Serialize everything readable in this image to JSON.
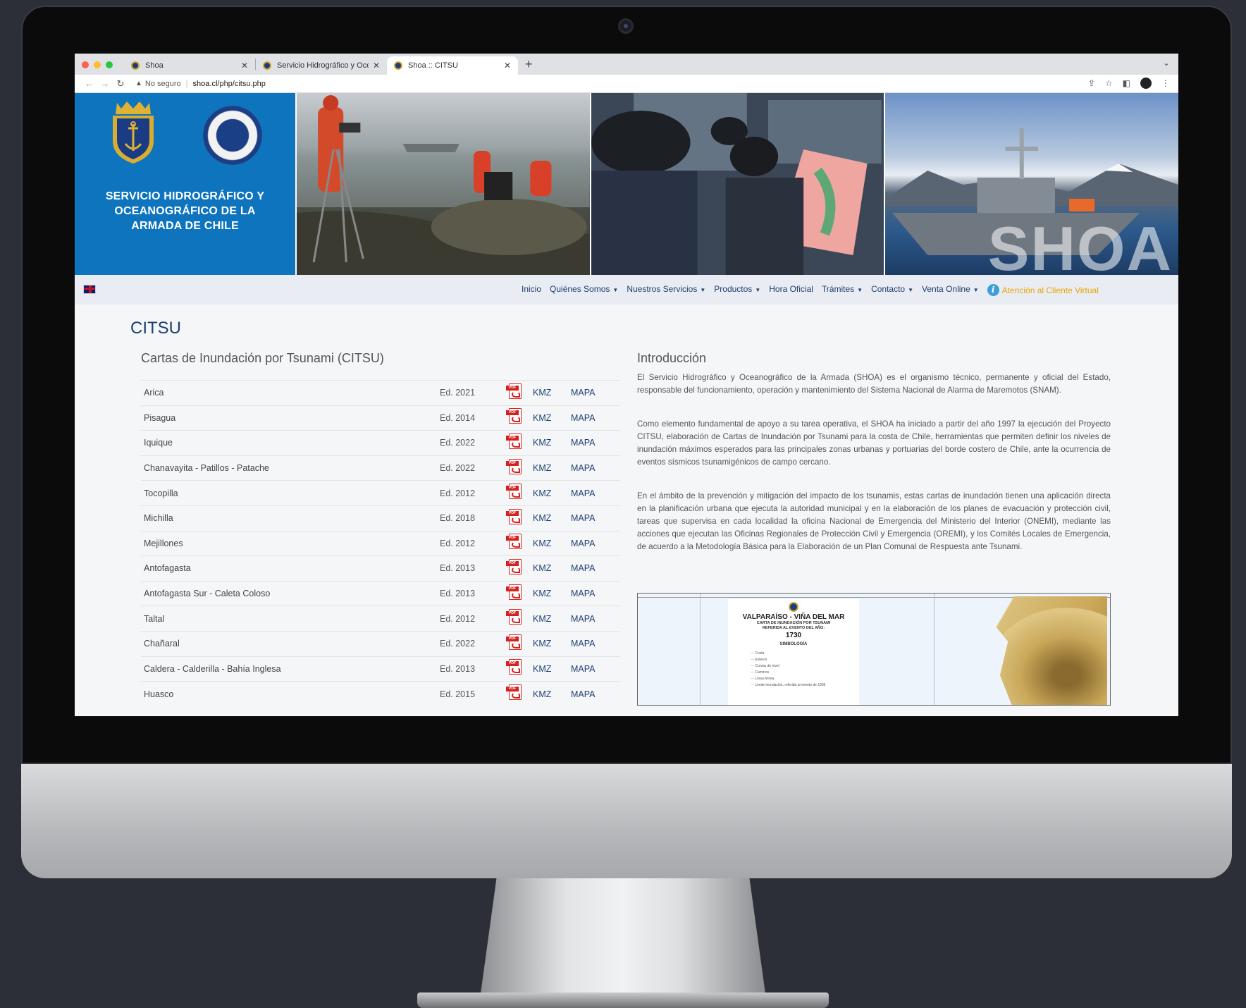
{
  "browser": {
    "tabs": [
      {
        "title": "Shoa",
        "active": false
      },
      {
        "title": "Servicio Hidrográfico y Oceanó",
        "active": false
      },
      {
        "title": "Shoa :: CITSU",
        "active": true
      }
    ],
    "security_label": "No seguro",
    "url_host": "shoa.cl",
    "url_path": "/php/citsu.php"
  },
  "banner": {
    "org_name": "SERVICIO HIDROGRÁFICO Y OCEANOGRÁFICO DE LA ARMADA DE CHILE",
    "watermark": "SHOA",
    "brand_color": "#0d74bd"
  },
  "nav": {
    "items": [
      {
        "label": "Inicio",
        "dropdown": false
      },
      {
        "label": "Quiénes Somos",
        "dropdown": true
      },
      {
        "label": "Nuestros Servicios",
        "dropdown": true
      },
      {
        "label": "Productos",
        "dropdown": true
      },
      {
        "label": "Hora Oficial",
        "dropdown": false
      },
      {
        "label": "Trámites",
        "dropdown": true
      },
      {
        "label": "Contacto",
        "dropdown": true
      },
      {
        "label": "Venta Online",
        "dropdown": true
      }
    ],
    "assist_label": "Atención al Cliente Virtual",
    "assist_color": "#e8a300"
  },
  "page": {
    "title": "CITSU",
    "section_title": "Cartas de Inundación por Tsunami (CITSU)",
    "kmz_label": "KMZ",
    "mapa_label": "MAPA",
    "charts": [
      {
        "name": "Arica",
        "edition": "Ed. 2021"
      },
      {
        "name": "Pisagua",
        "edition": "Ed. 2014"
      },
      {
        "name": "Iquique",
        "edition": "Ed. 2022"
      },
      {
        "name": "Chanavayita - Patillos - Patache",
        "edition": "Ed. 2022"
      },
      {
        "name": "Tocopilla",
        "edition": "Ed. 2012"
      },
      {
        "name": "Michilla",
        "edition": "Ed. 2018"
      },
      {
        "name": "Mejillones",
        "edition": "Ed. 2012"
      },
      {
        "name": "Antofagasta",
        "edition": "Ed. 2013"
      },
      {
        "name": "Antofagasta Sur - Caleta Coloso",
        "edition": "Ed. 2013"
      },
      {
        "name": "Taltal",
        "edition": "Ed. 2012"
      },
      {
        "name": "Chañaral",
        "edition": "Ed. 2022"
      },
      {
        "name": "Caldera - Calderilla - Bahía Inglesa",
        "edition": "Ed. 2013"
      },
      {
        "name": "Huasco",
        "edition": "Ed. 2015"
      }
    ]
  },
  "intro": {
    "title": "Introducción",
    "paragraphs": [
      "El Servicio Hidrográfico y Oceanográfico de la Armada (SHOA) es el organismo técnico, permanente y oficial del Estado, responsable del funcionamiento, operación y mantenimiento del Sistema Nacional de Alarma de Maremotos (SNAM).",
      "Como elemento fundamental de apoyo a su tarea operativa, el SHOA ha iniciado a partir del año 1997 la ejecución del Proyecto CITSU, elaboración de Cartas de Inundación por Tsunami para la costa de Chile, herramientas que permiten definir los niveles de inundación máximos esperados para las principales zonas urbanas y portuarias del borde costero de Chile, ante la ocurrencia de eventos sísmicos tsunamigénicos de campo cercano.",
      "En el ámbito de la prevención y mitigación del impacto de los tsunamis, estas cartas de inundación tienen una aplicación directa en la planificación urbana que ejecuta la autoridad municipal y en la elaboración de los planes de evacuación y protección civil, tareas que supervisa en cada localidad la oficina Nacional de Emergencia del Ministerio del Interior (ONEMI), mediante las acciones que ejecutan las Oficinas Regionales de Protección Civil y Emergencia (OREMI), y los Comités Locales de Emergencia, de acuerdo a la Metodología Básica para la Elaboración de un Plan Comunal de Respuesta ante Tsunami."
    ]
  },
  "map_preview": {
    "city": "VALPARAÍSO - VIÑA DEL MAR",
    "subtitle_1": "CARTA DE INUNDACIÓN POR TSUNAMI",
    "subtitle_2": "REFERIDA AL EVENTO DEL AÑO:",
    "year": "1730",
    "legend_title": "SIMBOLOGÍA",
    "legend_items": [
      "Costa",
      "Esteros",
      "Curvas de nivel",
      "Caminos",
      "Línea férrea",
      "Límite inundación, referida al evento de 1906"
    ]
  }
}
